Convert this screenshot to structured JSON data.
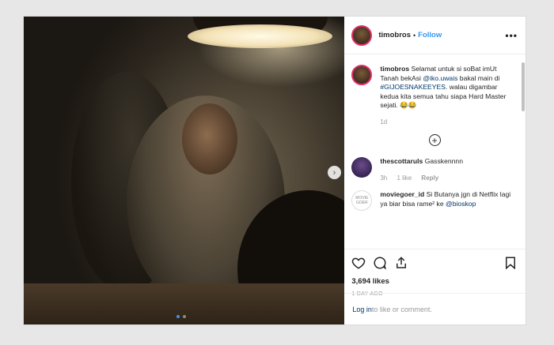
{
  "post": {
    "username": "timobros",
    "follow_label": "Follow",
    "separator": "•",
    "more_label": "•••"
  },
  "caption": {
    "username": "timobros",
    "part1": "Selamat untuk si soBat imUt Tanah bekAsi ",
    "mention": "@iko.uwais",
    "part2": " bakal main di ",
    "hashtag": "#GIJOESNAKEEYES",
    "part3": ". walau digambar kedua kita semua tahu siapa Hard Master sejati. 😂😂",
    "time": "1d"
  },
  "load_more": "+",
  "comments": [
    {
      "username": "thescottaruls",
      "text": "Gasskennnn",
      "time": "3h",
      "likes": "1 like",
      "reply": "Reply"
    },
    {
      "username": "moviegoer_id",
      "text_pre": "Si Butanya jgn di Netflix lagi ya biar bisa rame² ke ",
      "mention": "@bioskop",
      "avatar_text": "MOVIE GOER"
    }
  ],
  "likes": "3,694 likes",
  "date": "1 DAY AGO",
  "login": {
    "link": "Log in",
    "text": " to like or comment."
  },
  "next_icon": "chevron-right-icon"
}
